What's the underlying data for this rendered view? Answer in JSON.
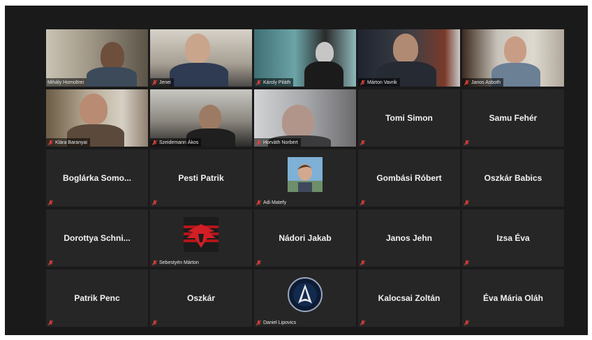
{
  "participants": [
    {
      "name": "Mihály Homoltrei",
      "type": "video",
      "active": true
    },
    {
      "name": "Jenei",
      "type": "video"
    },
    {
      "name": "Károly Piláth",
      "type": "video"
    },
    {
      "name": "Márton Vavrik",
      "type": "video"
    },
    {
      "name": "Janos Asboth",
      "type": "video"
    },
    {
      "name": "Klára Baranyai",
      "type": "video"
    },
    {
      "name": "Szeidemann Ákos",
      "type": "video"
    },
    {
      "name": "Horváth Norbert",
      "type": "video"
    },
    {
      "name": "Tomi Simon",
      "type": "name"
    },
    {
      "name": "Samu Fehér",
      "type": "name"
    },
    {
      "name": "Boglárka Somo...",
      "type": "name"
    },
    {
      "name": "Pesti Patrik",
      "type": "name"
    },
    {
      "name": "Adi Matefy",
      "type": "avatar",
      "avatar_icon": "profile-photo-icon"
    },
    {
      "name": "Gombási Róbert",
      "type": "name"
    },
    {
      "name": "Oszkár Babics",
      "type": "name"
    },
    {
      "name": "Dorottya Schni...",
      "type": "name"
    },
    {
      "name": "Sebestyén Márton",
      "type": "avatar",
      "avatar_icon": "eagle-emblem-icon"
    },
    {
      "name": "Nádori Jakab",
      "type": "name"
    },
    {
      "name": "Janos Jehn",
      "type": "name"
    },
    {
      "name": "Izsa Éva",
      "type": "name"
    },
    {
      "name": "Patrik Penc",
      "type": "name"
    },
    {
      "name": "Oszkár",
      "type": "name"
    },
    {
      "name": "Daniel Lipovics",
      "type": "avatar",
      "avatar_icon": "starfleet-badge-icon"
    },
    {
      "name": "Kalocsai Zoltán",
      "type": "name"
    },
    {
      "name": "Éva Mária Oláh",
      "type": "name"
    }
  ],
  "colors": {
    "background": "#1a1a1a",
    "tile": "#262626",
    "active_outline": "#b7d25a",
    "muted_icon": "#e0423d"
  }
}
